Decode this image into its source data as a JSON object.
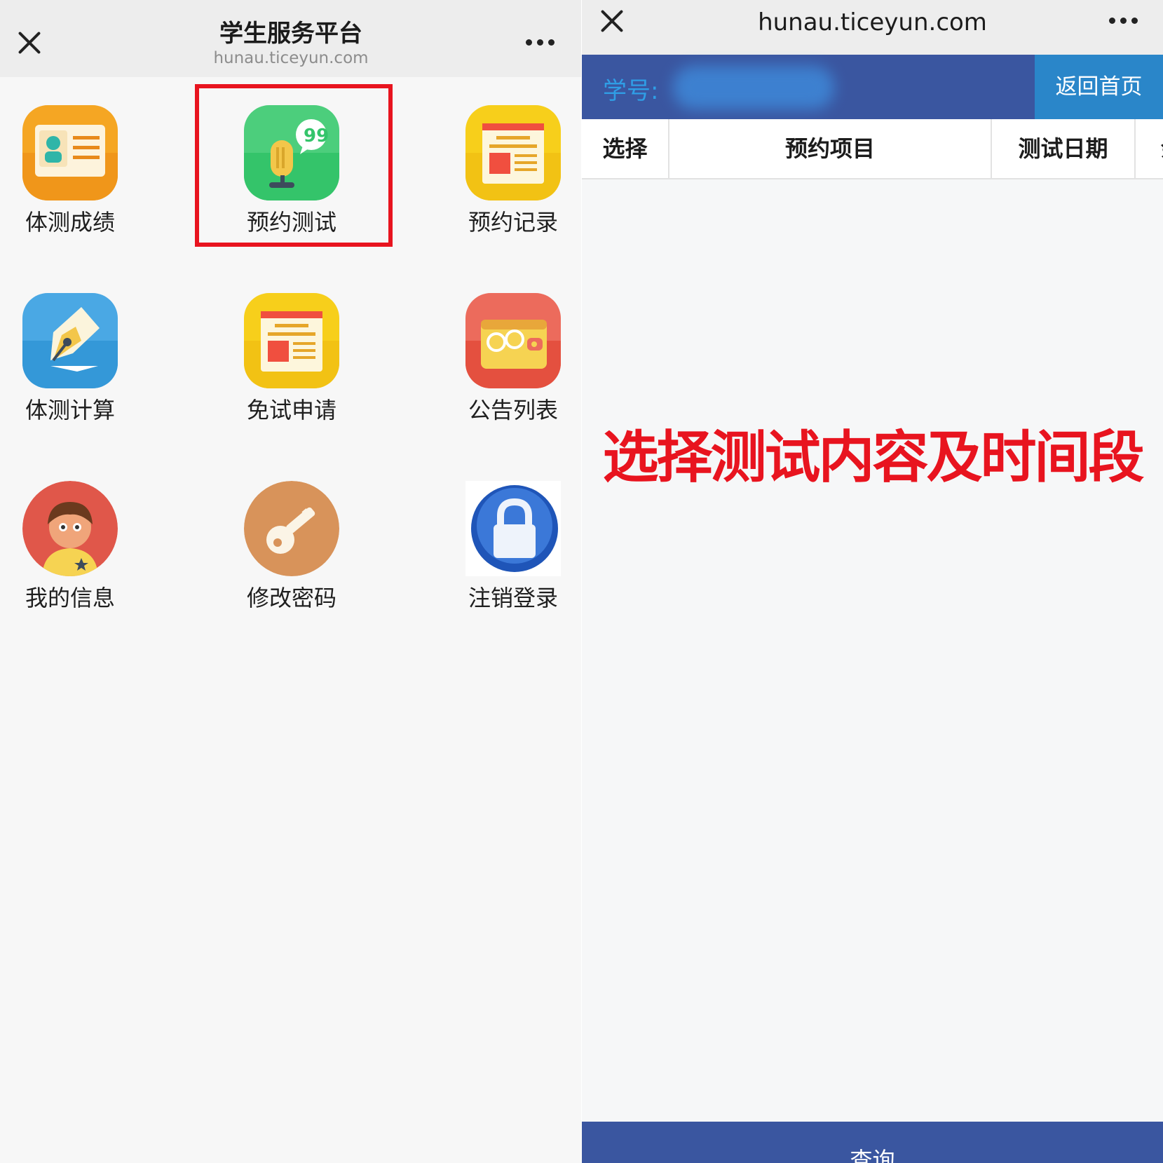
{
  "left_app": {
    "title": "学生服务平台",
    "url": "hunau.ticeyun.com",
    "tiles": [
      {
        "label": "体测成绩",
        "icon": "id-card-icon"
      },
      {
        "label": "预约测试",
        "icon": "microphone-icon"
      },
      {
        "label": "预约记录",
        "icon": "document-icon"
      },
      {
        "label": "体测计算",
        "icon": "pen-nib-icon"
      },
      {
        "label": "免试申请",
        "icon": "document-icon"
      },
      {
        "label": "公告列表",
        "icon": "wallet-icon"
      },
      {
        "label": "我的信息",
        "icon": "person-avatar-icon"
      },
      {
        "label": "修改密码",
        "icon": "key-icon"
      },
      {
        "label": "注销登录",
        "icon": "lock-icon"
      }
    ],
    "highlighted_tile": "预约测试"
  },
  "right_app": {
    "title": "hunau.ticeyun.com",
    "student_label": "学号:",
    "home_button": "返回首页",
    "table_headers": [
      "选择",
      "预约项目",
      "测试日期",
      "余量"
    ],
    "overlay_caption": "选择测试内容及时间段",
    "query_button": "查询"
  },
  "colors": {
    "header_blue": "#3a56a0",
    "home_button_blue": "#2a86c9",
    "student_label_blue": "#2f9ee6",
    "highlight_red": "#e8141f"
  }
}
